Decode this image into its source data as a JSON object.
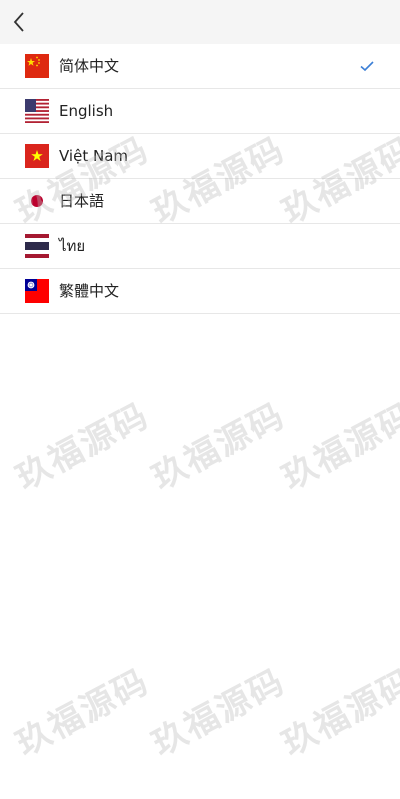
{
  "languages": [
    {
      "label": "简体中文",
      "flag": "china-flag-icon",
      "selected": true
    },
    {
      "label": "English",
      "flag": "usa-flag-icon",
      "selected": false
    },
    {
      "label": "Việt Nam",
      "flag": "vietnam-flag-icon",
      "selected": false
    },
    {
      "label": "日本語",
      "flag": "japan-flag-icon",
      "selected": false
    },
    {
      "label": "ไทย",
      "flag": "thailand-flag-icon",
      "selected": false
    },
    {
      "label": "繁體中文",
      "flag": "taiwan-flag-icon",
      "selected": false
    }
  ],
  "watermark": "玖福源码",
  "colors": {
    "check": "#3c7fd6",
    "topbar": "#f5f5f5",
    "divider": "#e7e7e7"
  }
}
